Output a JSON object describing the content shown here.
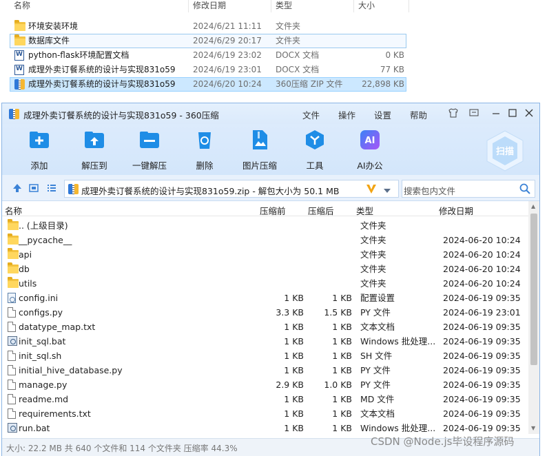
{
  "explorer": {
    "headers": [
      "名称",
      "修改日期",
      "类型",
      "大小"
    ],
    "rows": [
      {
        "name": "环境安装环境",
        "date": "2024/6/21 11:11",
        "type": "文件夹",
        "size": "",
        "icon": "folder-icon"
      },
      {
        "name": "数据库文件",
        "date": "2024/6/29 20:17",
        "type": "文件夹",
        "size": "",
        "icon": "folder-icon"
      },
      {
        "name": "python-flask环境配置文档",
        "date": "2024/6/19 23:02",
        "type": "DOCX 文档",
        "size": "0 KB",
        "icon": "word-doc-icon"
      },
      {
        "name": "成理外卖订餐系统的设计与实现831o59",
        "date": "2024/6/19 23:01",
        "type": "DOCX 文档",
        "size": "77 KB",
        "icon": "word-doc-icon"
      },
      {
        "name": "成理外卖订餐系统的设计与实现831o59",
        "date": "2024/6/20 10:24",
        "type": "360压缩 ZIP 文件",
        "size": "22,898 KB",
        "icon": "zip-archive-icon"
      }
    ]
  },
  "archive_window": {
    "title": "成理外卖订餐系统的设计与实现831o59 - 360压缩",
    "menu": [
      "文件",
      "操作",
      "设置",
      "帮助"
    ],
    "toolbar": [
      {
        "label": "添加",
        "icon": "add-icon",
        "color": "#1f8de6"
      },
      {
        "label": "解压到",
        "icon": "extract-to-icon",
        "color": "#1f8de6"
      },
      {
        "label": "一键解压",
        "icon": "one-click-extract-icon",
        "color": "#1f8de6"
      },
      {
        "label": "删除",
        "icon": "delete-icon",
        "color": "#1f8de6"
      },
      {
        "label": "图片压缩",
        "icon": "image-compress-icon",
        "color": "#1f8de6"
      },
      {
        "label": "工具",
        "icon": "tools-icon",
        "color": "#1f8de6"
      },
      {
        "label": "AI办公",
        "icon": "ai-office-icon",
        "color": "#8a5cf6"
      }
    ],
    "scan_label": "扫描",
    "address": "成理外卖订餐系统的设计与实现831o59.zip - 解包大小为 50.1 MB",
    "search_placeholder": "搜索包内文件",
    "columns": [
      "名称",
      "压缩前",
      "压缩后",
      "类型",
      "修改日期"
    ],
    "files": [
      {
        "name": ".. (上级目录)",
        "comp": "",
        "orig": "",
        "type": "文件夹",
        "date": "",
        "icon": "folder-icon"
      },
      {
        "name": "__pycache__",
        "comp": "",
        "orig": "",
        "type": "文件夹",
        "date": "2024-06-20 10:24",
        "icon": "folder-icon"
      },
      {
        "name": "api",
        "comp": "",
        "orig": "",
        "type": "文件夹",
        "date": "2024-06-20 10:24",
        "icon": "folder-icon"
      },
      {
        "name": "db",
        "comp": "",
        "orig": "",
        "type": "文件夹",
        "date": "2024-06-20 10:24",
        "icon": "folder-icon"
      },
      {
        "name": "utils",
        "comp": "",
        "orig": "",
        "type": "文件夹",
        "date": "2024-06-20 10:24",
        "icon": "folder-icon"
      },
      {
        "name": "config.ini",
        "comp": "1 KB",
        "orig": "1 KB",
        "type": "配置设置",
        "date": "2024-06-19 09:35",
        "icon": "config-file-icon"
      },
      {
        "name": "configs.py",
        "comp": "3.3 KB",
        "orig": "1.5 KB",
        "type": "PY 文件",
        "date": "2024-06-19 23:01",
        "icon": "file-icon"
      },
      {
        "name": "datatype_map.txt",
        "comp": "1 KB",
        "orig": "1 KB",
        "type": "文本文档",
        "date": "2024-06-19 09:35",
        "icon": "file-icon"
      },
      {
        "name": "init_sql.bat",
        "comp": "1 KB",
        "orig": "1 KB",
        "type": "Windows 批处理...",
        "date": "2024-06-19 09:35",
        "icon": "batch-file-icon"
      },
      {
        "name": "init_sql.sh",
        "comp": "1 KB",
        "orig": "1 KB",
        "type": "SH 文件",
        "date": "2024-06-19 09:35",
        "icon": "file-icon"
      },
      {
        "name": "initial_hive_database.py",
        "comp": "1 KB",
        "orig": "1 KB",
        "type": "PY 文件",
        "date": "2024-06-19 09:35",
        "icon": "file-icon"
      },
      {
        "name": "manage.py",
        "comp": "2.9 KB",
        "orig": "1.0 KB",
        "type": "PY 文件",
        "date": "2024-06-19 09:35",
        "icon": "file-icon"
      },
      {
        "name": "readme.md",
        "comp": "1 KB",
        "orig": "1 KB",
        "type": "MD 文件",
        "date": "2024-06-19 09:35",
        "icon": "file-icon"
      },
      {
        "name": "requirements.txt",
        "comp": "1 KB",
        "orig": "1 KB",
        "type": "文本文档",
        "date": "2024-06-19 09:35",
        "icon": "file-icon"
      },
      {
        "name": "run.bat",
        "comp": "1 KB",
        "orig": "1 KB",
        "type": "Windows 批处理...",
        "date": "2024-06-19 09:35",
        "icon": "batch-file-icon"
      }
    ],
    "status": "大小: 22.2 MB 共 640 个文件和 114 个文件夹 压缩率 44.3%"
  },
  "watermark": "CSDN @Node.js毕设程序源码"
}
